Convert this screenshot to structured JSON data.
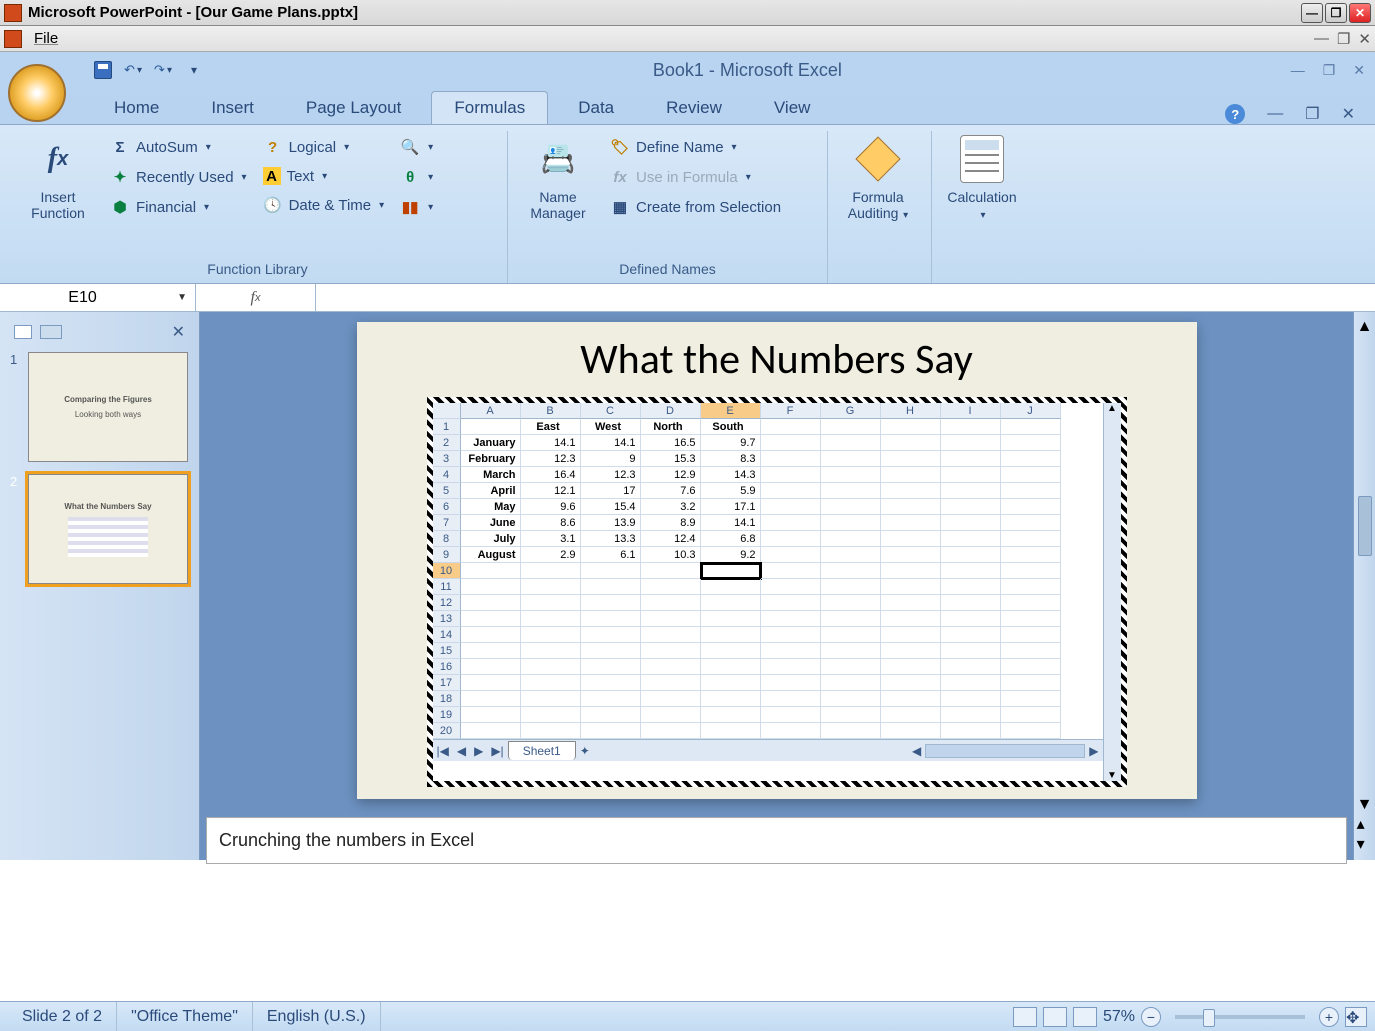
{
  "os": {
    "title": "Microsoft PowerPoint - [Our Game Plans.pptx]"
  },
  "menu": {
    "file": "File"
  },
  "excel": {
    "title": "Book1 - Microsoft Excel",
    "tabs": [
      "Home",
      "Insert",
      "Page Layout",
      "Formulas",
      "Data",
      "Review",
      "View"
    ],
    "activeTab": "Formulas",
    "ribbon": {
      "insertFunction": "Insert Function",
      "autosum": "AutoSum",
      "recentlyUsed": "Recently Used",
      "financial": "Financial",
      "logical": "Logical",
      "text": "Text",
      "dateTime": "Date & Time",
      "functionLibrary": "Function Library",
      "nameManager": "Name Manager",
      "defineName": "Define Name",
      "useInFormula": "Use in Formula",
      "createFromSelection": "Create from Selection",
      "definedNames": "Defined Names",
      "formulaAuditing": "Formula Auditing",
      "calculation": "Calculation"
    },
    "nameBox": "E10"
  },
  "slide": {
    "title": "What the Numbers Say",
    "thumb1_title": "Comparing the Figures",
    "thumb1_sub": "Looking both ways",
    "thumb2_title": "What the Numbers Say",
    "sheet": {
      "tabName": "Sheet1",
      "columns": [
        "",
        "A",
        "B",
        "C",
        "D",
        "E",
        "F",
        "G",
        "H",
        "I",
        "J"
      ],
      "headers": [
        "",
        "East",
        "West",
        "North",
        "South"
      ],
      "rows": [
        {
          "n": "2",
          "label": "January",
          "v": [
            "14.1",
            "14.1",
            "16.5",
            "9.7"
          ]
        },
        {
          "n": "3",
          "label": "February",
          "v": [
            "12.3",
            "9",
            "15.3",
            "8.3"
          ]
        },
        {
          "n": "4",
          "label": "March",
          "v": [
            "16.4",
            "12.3",
            "12.9",
            "14.3"
          ]
        },
        {
          "n": "5",
          "label": "April",
          "v": [
            "12.1",
            "17",
            "7.6",
            "5.9"
          ]
        },
        {
          "n": "6",
          "label": "May",
          "v": [
            "9.6",
            "15.4",
            "3.2",
            "17.1"
          ]
        },
        {
          "n": "7",
          "label": "June",
          "v": [
            "8.6",
            "13.9",
            "8.9",
            "14.1"
          ]
        },
        {
          "n": "8",
          "label": "July",
          "v": [
            "3.1",
            "13.3",
            "12.4",
            "6.8"
          ]
        },
        {
          "n": "9",
          "label": "August",
          "v": [
            "2.9",
            "6.1",
            "10.3",
            "9.2"
          ]
        }
      ],
      "selected": "E10"
    }
  },
  "notes": "Crunching the numbers in Excel",
  "status": {
    "slide": "Slide 2 of 2",
    "theme": "\"Office Theme\"",
    "lang": "English (U.S.)",
    "zoom": "57%"
  }
}
